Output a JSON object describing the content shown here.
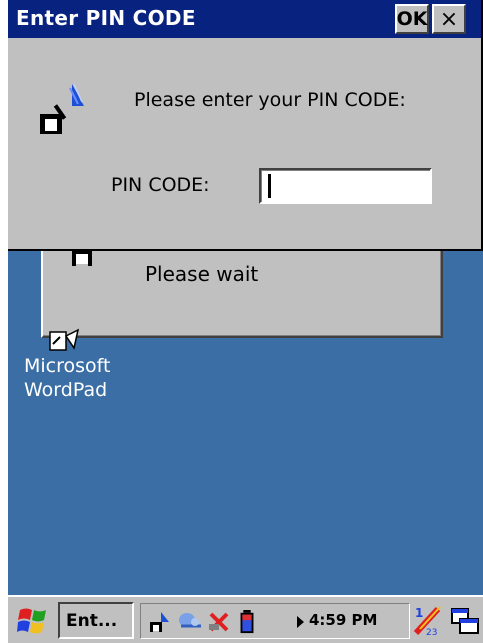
{
  "pin_dialog": {
    "title": "Enter PIN CODE",
    "ok_label": "OK",
    "close_label": "×",
    "prompt": "Please enter your PIN CODE:",
    "pin_label": "PIN CODE:",
    "pin_value": ""
  },
  "wait_dialog": {
    "message": "Please wait"
  },
  "desktop": {
    "icon_label_line1": "Microsoft",
    "icon_label_line2": "WordPad",
    "icon_name": "wordpad-icon"
  },
  "taskbar": {
    "task_button_label": "Ent...",
    "clock": "4:59 PM",
    "tray_icons": [
      "network-icon",
      "bluetooth-icon",
      "connection-icon",
      "battery-icon"
    ],
    "colors": {
      "title_bar": "#08227f",
      "desktop": "#3a6ea5",
      "dialog": "#c0c0c0"
    }
  }
}
